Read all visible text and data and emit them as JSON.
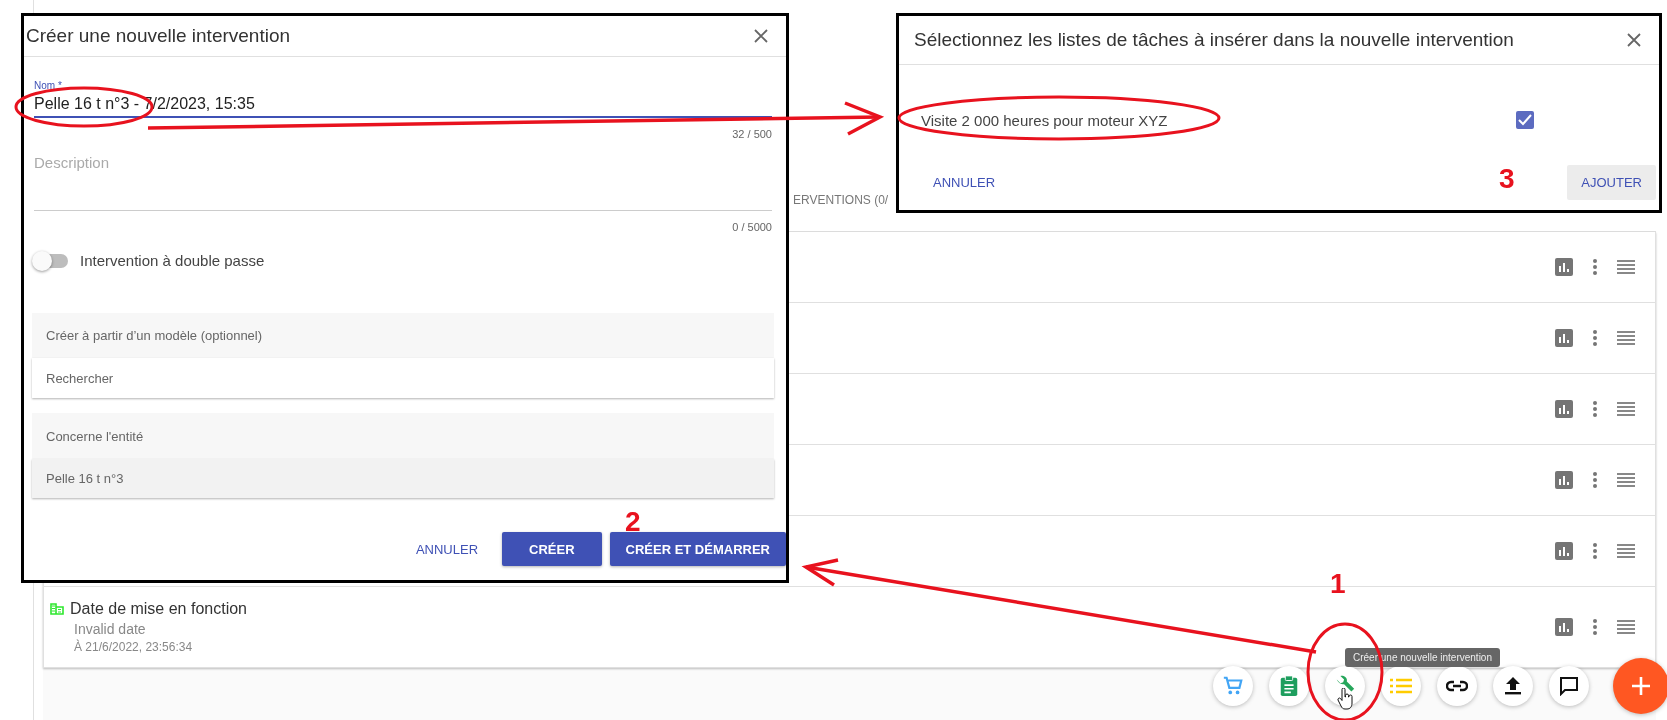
{
  "background": {
    "tab_fragment": "ERVENTIONS (0/",
    "rows": [
      {
        "kind": "covered"
      },
      {
        "kind": "covered"
      },
      {
        "kind": "covered"
      },
      {
        "kind": "covered"
      },
      {
        "kind": "covered"
      },
      {
        "kind": "event",
        "title": "Date de mise en fonction",
        "value": "Invalid date",
        "time": "À 21/6/2022, 23:56:34"
      }
    ],
    "tooltip": "Créer une nouvelle intervention"
  },
  "create_dialog": {
    "title": "Créer une nouvelle intervention",
    "name": {
      "label": "Nom *",
      "value": "Pelle 16 t n°3 - 7/2/2023, 15:35",
      "counter": "32 / 500"
    },
    "description": {
      "placeholder": "Description",
      "counter": "0 / 5000"
    },
    "double_pass": {
      "label": "Intervention à double passe",
      "on": false
    },
    "template": {
      "header": "Créer à partir d’un modèle (optionnel)",
      "placeholder": "Rechercher"
    },
    "entity": {
      "header": "Concerne l'entité",
      "value": "Pelle 16 t n°3"
    },
    "buttons": [
      "ANNULER",
      "CRÉER",
      "CRÉER ET DÉMARRER"
    ]
  },
  "task_dialog": {
    "title": "Sélectionnez les listes de tâches à insérer dans la nouvelle intervention",
    "items": [
      {
        "label": "Visite 2 000 heures pour moteur XYZ",
        "checked": true
      }
    ],
    "buttons": [
      "ANNULER",
      "AJOUTER"
    ]
  },
  "annotations": [
    {
      "label": "1"
    },
    {
      "label": "2"
    },
    {
      "label": "3"
    }
  ]
}
